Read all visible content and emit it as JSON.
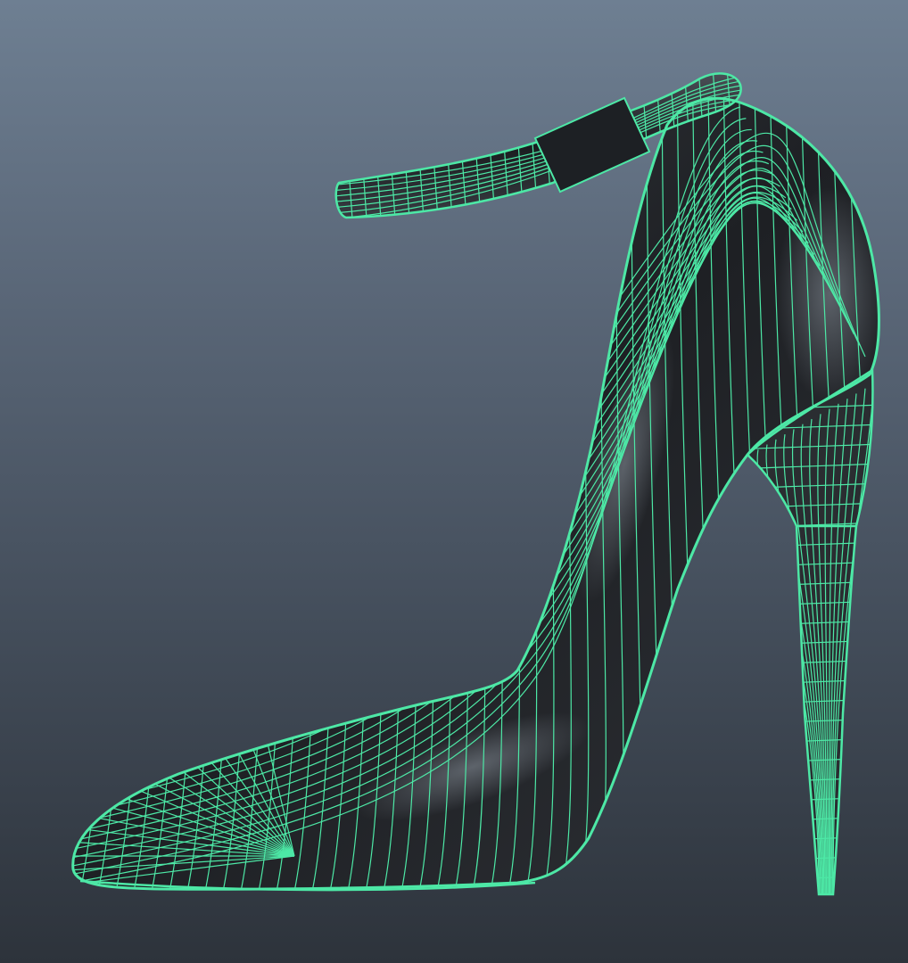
{
  "viewport": {
    "display_mode": "wireframe-on-shaded",
    "background_colors": [
      "#6e7f92",
      "#2d333b"
    ],
    "wire_color": "#4de8a6",
    "surface_color": "#2a2d31"
  },
  "model": {
    "object": "high-heel-pump",
    "parts": [
      "ankle-strap",
      "strap-buckle",
      "upper",
      "sole",
      "stiletto-heel"
    ]
  }
}
